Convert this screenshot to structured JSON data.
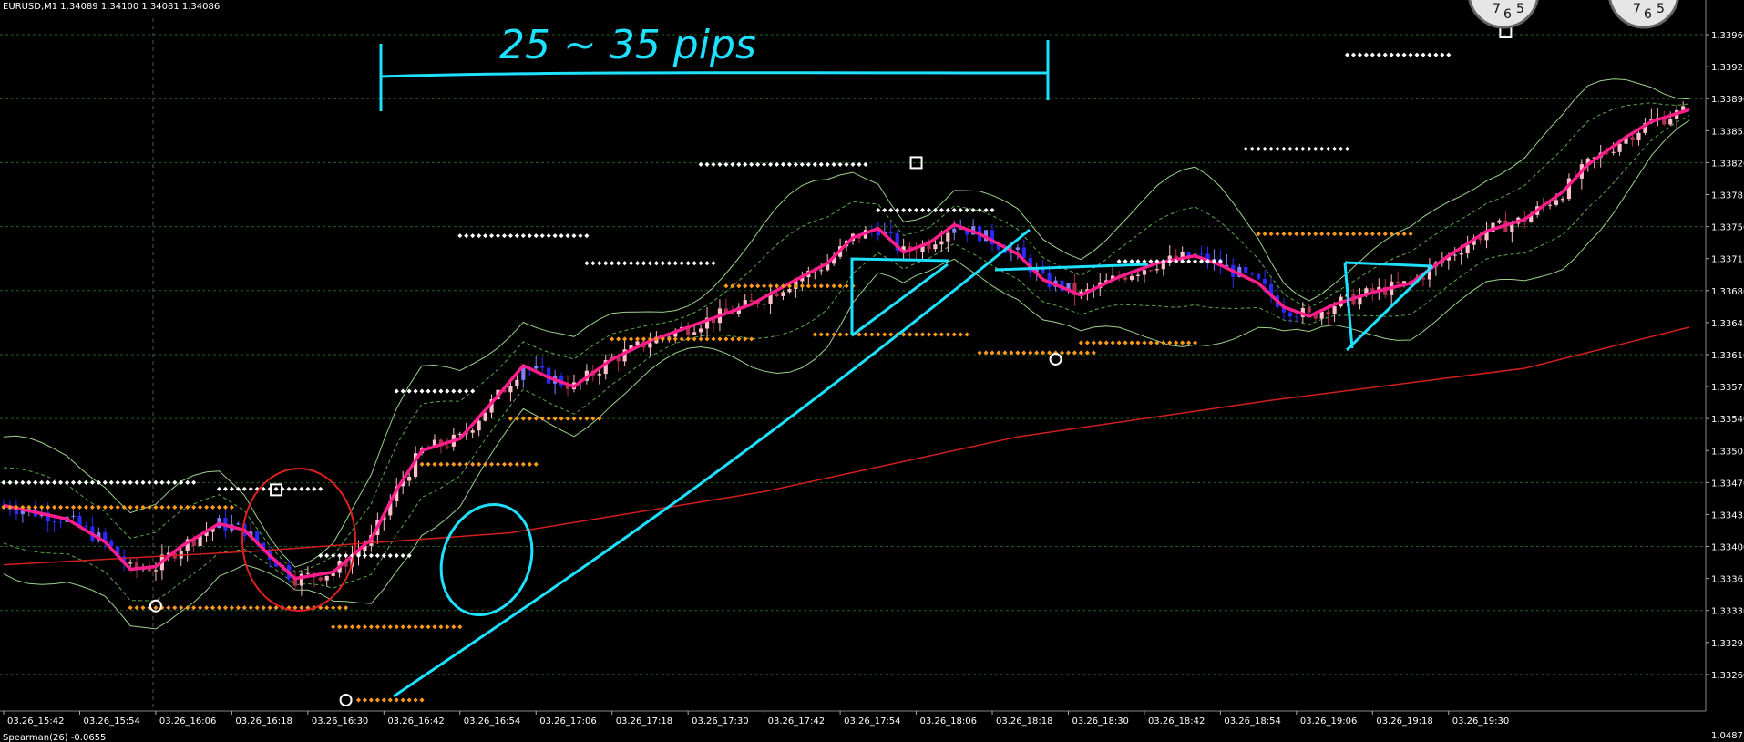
{
  "header": {
    "symbol_line": "EURUSD,M1  1.34089 1.34100 1.34081 1.34086"
  },
  "annotation": {
    "handwritten": "25 ~ 35 pips"
  },
  "indicator": {
    "label": "Spearman(26) -0.0655",
    "right_value": "1.0487"
  },
  "colors": {
    "background": "#000000",
    "bull": "#e8a0b4",
    "bear": "#3a3aff",
    "ma_fast": "#ff1e8c",
    "ma_slow": "#d21e1e",
    "annotation": "#1ee0ff",
    "circle": "#e02020",
    "dots_white": "#ffffff",
    "dots_orange": "#ff9a1a",
    "band": "#9bd28c",
    "grid": "#1f5f1f"
  },
  "chart_data": {
    "type": "line",
    "title": "EURUSD,M1",
    "ohlc_header": [
      1.34089,
      1.341,
      1.34081,
      1.34086
    ],
    "ylim": [
      1.3322,
      1.3398
    ],
    "y_ticks": [
      "1.33960",
      "1.33925",
      "1.33890",
      "1.33855",
      "1.33820",
      "1.33785",
      "1.33750",
      "1.33715",
      "1.33680",
      "1.33645",
      "1.33610",
      "1.33575",
      "1.33540",
      "1.33505",
      "1.33470",
      "1.33435",
      "1.33400",
      "1.33365",
      "1.33330",
      "1.33295",
      "1.33260"
    ],
    "x_ticks": [
      "03.26_15:42",
      "03.26_15:54",
      "03.26_16:06",
      "03.26_16:18",
      "03.26_16:30",
      "03.26_16:42",
      "03.26_16:54",
      "03.26_17:06",
      "03.26_17:18",
      "03.26_17:30",
      "03.26_17:42",
      "03.26_17:54",
      "03.26_18:06",
      "03.26_18:18",
      "03.26_18:30",
      "03.26_18:42",
      "03.26_18:54",
      "03.26_19:06",
      "03.26_19:18",
      "03.26_19:30"
    ],
    "series": [
      {
        "name": "",
        "color": "#ff1e8c",
        "values": [
          [
            0,
            1.33445
          ],
          [
            10,
            1.3343
          ],
          [
            16,
            1.33405
          ],
          [
            20,
            1.33375
          ],
          [
            24,
            1.33378
          ],
          [
            28,
            1.334
          ],
          [
            34,
            1.33425
          ],
          [
            38,
            1.33418
          ],
          [
            42,
            1.3339
          ],
          [
            46,
            1.33365
          ],
          [
            52,
            1.33372
          ],
          [
            58,
            1.33408
          ],
          [
            62,
            1.33462
          ],
          [
            66,
            1.33505
          ],
          [
            72,
            1.33518
          ],
          [
            78,
            1.33565
          ],
          [
            82,
            1.33598
          ],
          [
            86,
            1.33585
          ],
          [
            90,
            1.33575
          ],
          [
            96,
            1.33605
          ],
          [
            102,
            1.33625
          ],
          [
            106,
            1.33635
          ],
          [
            112,
            1.3365
          ],
          [
            118,
            1.33665
          ],
          [
            124,
            1.33688
          ],
          [
            130,
            1.3371
          ],
          [
            134,
            1.33738
          ],
          [
            138,
            1.33748
          ],
          [
            142,
            1.33722
          ],
          [
            146,
            1.33732
          ],
          [
            150,
            1.33752
          ],
          [
            154,
            1.33742
          ],
          [
            160,
            1.3372
          ],
          [
            164,
            1.33692
          ],
          [
            170,
            1.33675
          ],
          [
            176,
            1.33695
          ],
          [
            182,
            1.3371
          ],
          [
            188,
            1.33718
          ],
          [
            192,
            1.33708
          ],
          [
            198,
            1.33688
          ],
          [
            202,
            1.33662
          ],
          [
            206,
            1.33652
          ],
          [
            210,
            1.33665
          ],
          [
            216,
            1.33678
          ],
          [
            222,
            1.33688
          ],
          [
            228,
            1.33718
          ],
          [
            234,
            1.33745
          ],
          [
            240,
            1.33758
          ],
          [
            246,
            1.33788
          ],
          [
            250,
            1.33818
          ],
          [
            256,
            1.33848
          ],
          [
            260,
            1.33865
          ],
          [
            266,
            1.33878
          ]
        ]
      },
      {
        "name": "",
        "color": "#d21e1e",
        "values": [
          [
            0,
            1.3338
          ],
          [
            40,
            1.33395
          ],
          [
            80,
            1.33415
          ],
          [
            120,
            1.3346
          ],
          [
            160,
            1.3352
          ],
          [
            200,
            1.3356
          ],
          [
            240,
            1.33595
          ],
          [
            266,
            1.3364
          ]
        ]
      }
    ],
    "x_unit": "bars (M1), 0 = 03.26 15:35",
    "grid": true,
    "legend": "none"
  }
}
